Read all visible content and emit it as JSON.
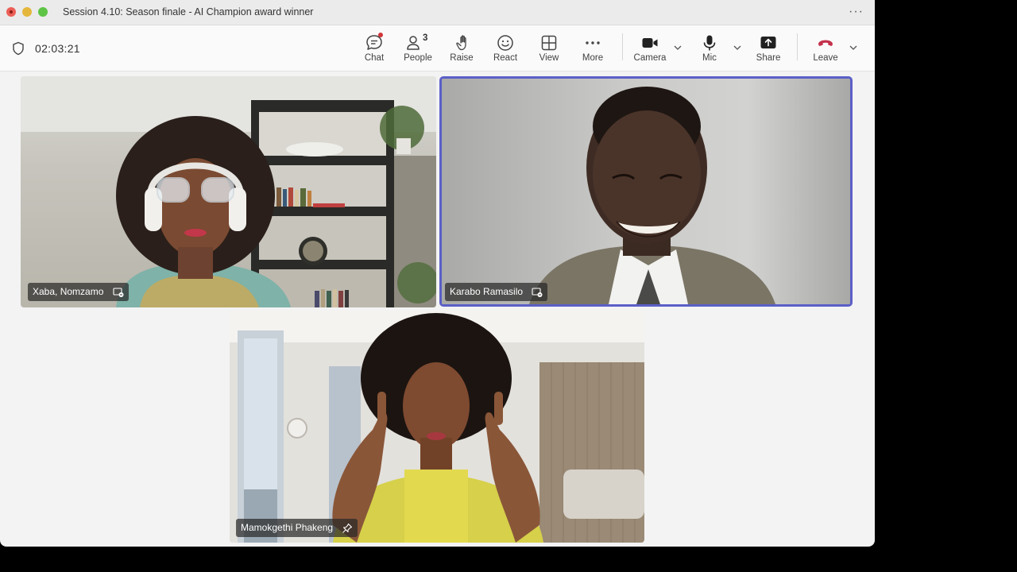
{
  "window": {
    "title": "Session 4.10: Season finale - AI Champion award winner"
  },
  "toolbar": {
    "timer": "02:03:21",
    "chat_label": "Chat",
    "people_label": "People",
    "people_count": "3",
    "raise_label": "Raise",
    "react_label": "React",
    "view_label": "View",
    "more_label": "More",
    "camera_label": "Camera",
    "mic_label": "Mic",
    "share_label": "Share",
    "leave_label": "Leave"
  },
  "participants": [
    {
      "name": "Xaba, Nomzamo"
    },
    {
      "name": "Karabo Ramasilo",
      "active_speaker": true
    },
    {
      "name": "Mamokgethi Phakeng",
      "pinned": true
    }
  ],
  "colors": {
    "active_border": "#5b5fc7",
    "leave_red": "#c4314b",
    "chat_dot": "#d13438"
  }
}
